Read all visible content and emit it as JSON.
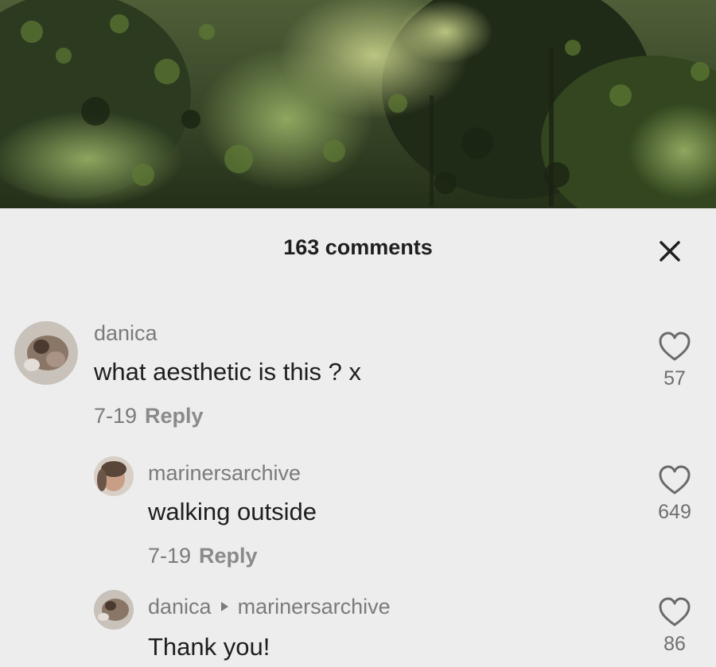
{
  "header": {
    "comments_count": "163 comments",
    "close_icon": "close-icon"
  },
  "comments": [
    {
      "username": "danica",
      "text": "what aesthetic is this ? x",
      "date": "7-19",
      "reply_label": "Reply",
      "likes": "57"
    },
    {
      "username": "marinersarchive",
      "text": "walking outside",
      "date": "7-19",
      "reply_label": "Reply",
      "likes": "649"
    },
    {
      "username": "danica",
      "reply_to": "marinersarchive",
      "text": "Thank you!",
      "likes": "86"
    }
  ],
  "colors": {
    "sheet_background": "#ededed",
    "primary_text": "#1e1e1e",
    "secondary_text": "#7b7b7b"
  }
}
